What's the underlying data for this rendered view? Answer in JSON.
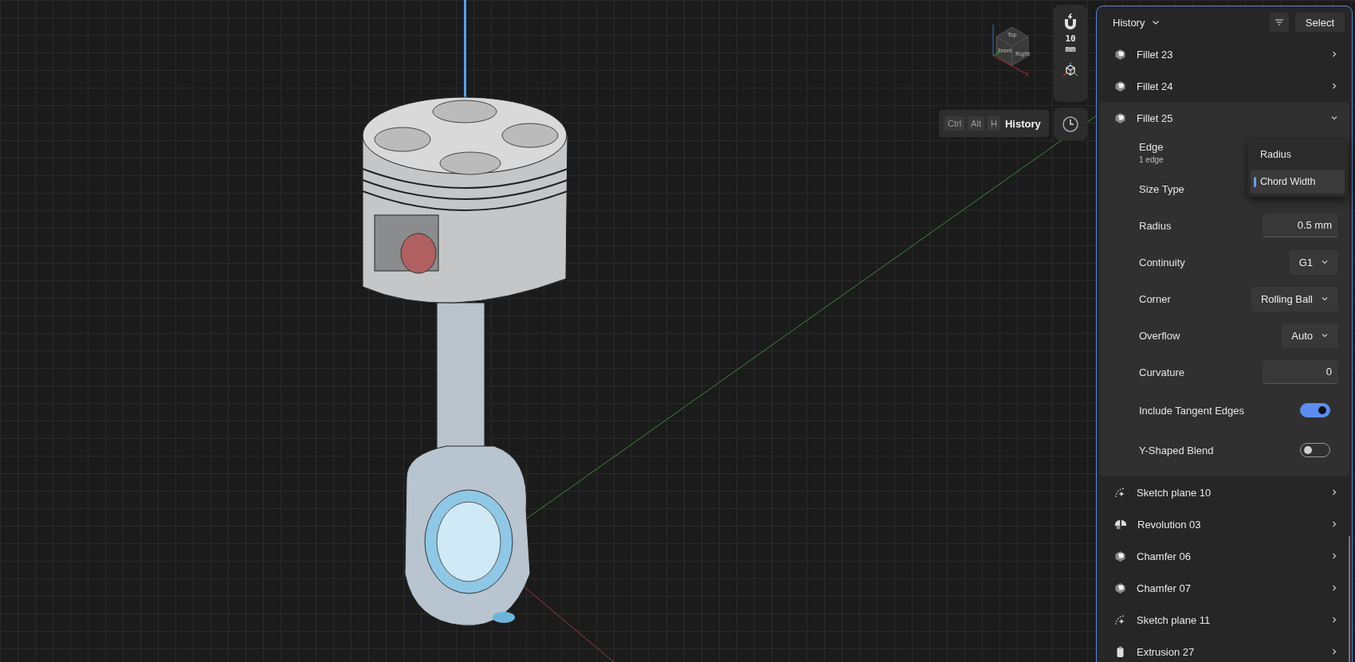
{
  "viewport": {
    "view_cube": {
      "faces": [
        "Top",
        "Front",
        "Right"
      ],
      "axis_label": "X"
    },
    "snap_toolbar": {
      "snap_value": "10",
      "snap_unit": "mm"
    },
    "shortcut_hint": {
      "keys": [
        "Ctrl",
        "Alt",
        "H"
      ],
      "label": "History"
    }
  },
  "history_panel": {
    "title": "History",
    "select_button": "Select",
    "items": [
      {
        "kind": "fillet",
        "label": "Fillet 23",
        "expanded": false
      },
      {
        "kind": "fillet",
        "label": "Fillet 24",
        "expanded": false
      },
      {
        "kind": "fillet",
        "label": "Fillet 25",
        "expanded": true,
        "properties": [
          {
            "kind": "picker",
            "label": "Edge",
            "sublabel": "1 edge"
          },
          {
            "kind": "menu",
            "label": "Size Type",
            "options": [
              {
                "label": "Radius",
                "selected": false
              },
              {
                "label": "Chord Width",
                "selected": true
              }
            ]
          },
          {
            "kind": "number",
            "label": "Radius",
            "value": "0.5 mm"
          },
          {
            "kind": "dropdown",
            "label": "Continuity",
            "value": "G1"
          },
          {
            "kind": "dropdown",
            "label": "Corner",
            "value": "Rolling Ball"
          },
          {
            "kind": "dropdown",
            "label": "Overflow",
            "value": "Auto"
          },
          {
            "kind": "number",
            "label": "Curvature",
            "value": "0"
          },
          {
            "kind": "toggle",
            "label": "Include Tangent Edges",
            "on": true
          },
          {
            "kind": "toggle",
            "label": "Y-Shaped Blend",
            "on": false
          }
        ]
      },
      {
        "kind": "sketch",
        "label": "Sketch plane 10",
        "expanded": false
      },
      {
        "kind": "revolution",
        "label": "Revolution 03",
        "expanded": false
      },
      {
        "kind": "chamfer",
        "label": "Chamfer 06",
        "expanded": false
      },
      {
        "kind": "chamfer",
        "label": "Chamfer 07",
        "expanded": false
      },
      {
        "kind": "sketch",
        "label": "Sketch plane 11",
        "expanded": false
      },
      {
        "kind": "extrusion",
        "label": "Extrusion 27",
        "expanded": false
      }
    ]
  }
}
